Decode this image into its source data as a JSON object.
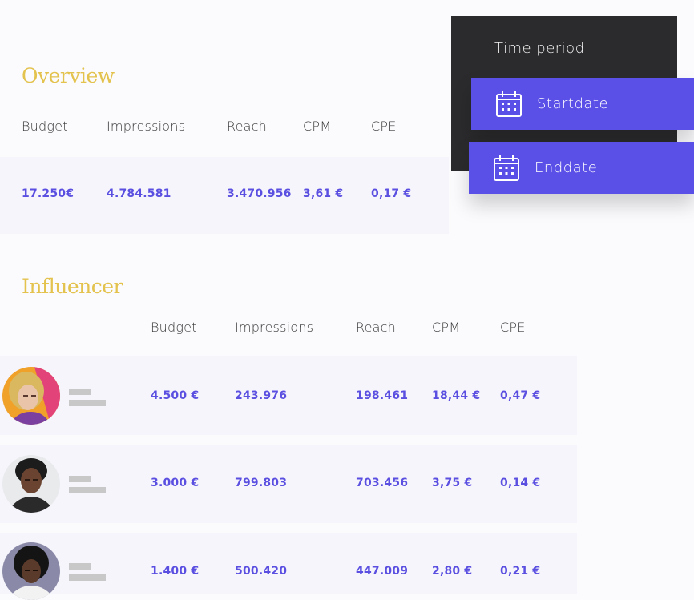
{
  "overview": {
    "title": "Overview",
    "headers": [
      "Budget",
      "Impressions",
      "Reach",
      "CPM",
      "CPE"
    ],
    "values": [
      "17.250€",
      "4.784.581",
      "3.470.956",
      "3,61 €",
      "0,17 €"
    ]
  },
  "influencer": {
    "title": "Influencer",
    "headers": [
      "Budget",
      "Impressions",
      "Reach",
      "CPM",
      "CPE"
    ],
    "rows": [
      {
        "budget": "4.500 €",
        "impressions": "243.976",
        "reach": "198.461",
        "cpm": "18,44 €",
        "cpe": "0,47 €"
      },
      {
        "budget": "3.000 €",
        "impressions": "799.803",
        "reach": "703.456",
        "cpm": "3,75 €",
        "cpe": "0,14 €"
      },
      {
        "budget": "1.400 €",
        "impressions": "500.420",
        "reach": "447.009",
        "cpm": "2,80 €",
        "cpe": "0,21 €"
      }
    ]
  },
  "time_period": {
    "title": "Time period",
    "start_label": "Startdate",
    "end_label": "Enddate"
  },
  "colors": {
    "accent": "#5a4fe6",
    "title_gold": "#e3c24d",
    "panel_dark": "#2b2b2d"
  }
}
